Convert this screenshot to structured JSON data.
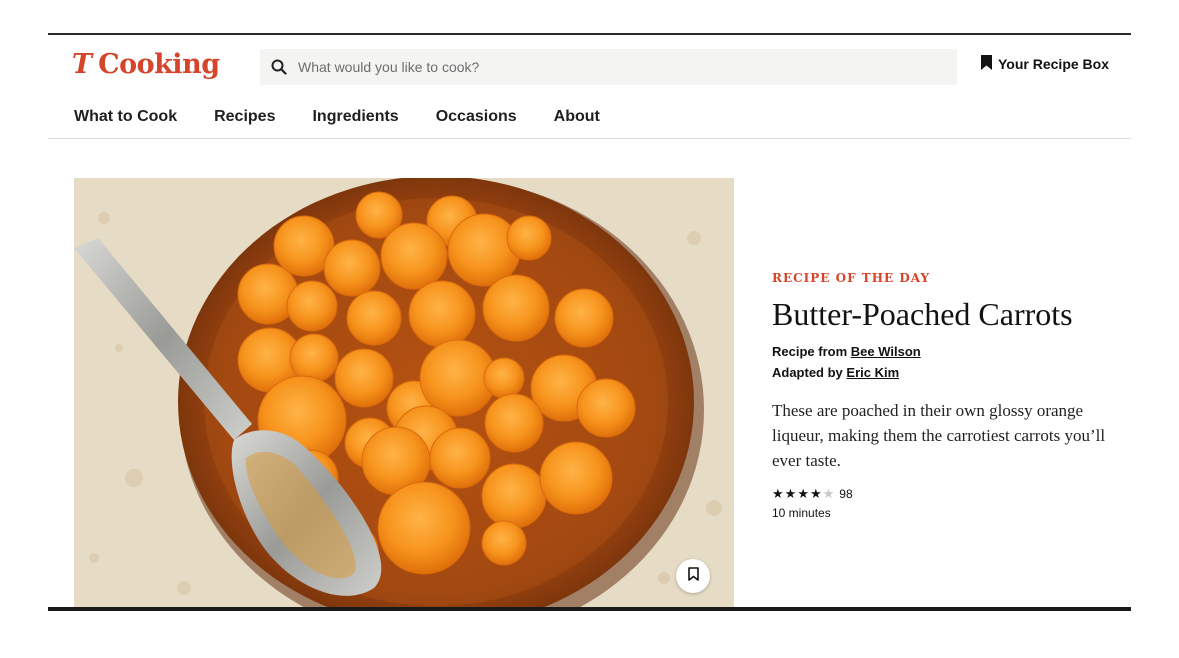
{
  "header": {
    "logo_mark": "T",
    "logo_text": "Cooking",
    "search_placeholder": "What would you like to cook?",
    "recipe_box_label": "Your Recipe Box"
  },
  "nav": {
    "items": [
      "What to Cook",
      "Recipes",
      "Ingredients",
      "Occasions",
      "About"
    ]
  },
  "recipe": {
    "kicker": "RECIPE OF THE DAY",
    "title": "Butter-Poached Carrots",
    "recipe_from_label": "Recipe from",
    "recipe_from_author": "Bee Wilson",
    "adapted_by_label": "Adapted by",
    "adapted_by_author": "Eric Kim",
    "description": "These are poached in their own glossy orange liqueur, making them the carrotiest carrots you’ll ever taste.",
    "rating_stars": 4,
    "rating_max": 5,
    "rating_count": "98",
    "time": "10 minutes"
  },
  "colors": {
    "brand_red": "#d4452b",
    "search_bg": "#f4f4f2"
  },
  "icons": {
    "search": "search-icon",
    "bookmark": "bookmark-icon",
    "save": "save-bookmark-icon"
  }
}
